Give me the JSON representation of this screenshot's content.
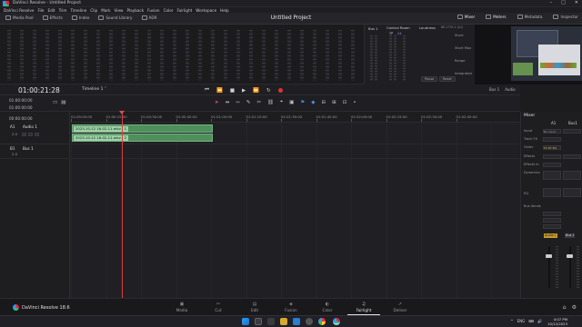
{
  "window": {
    "title": "DaVinci Resolve - Untitled Project",
    "controls": [
      "–",
      "□",
      "✕"
    ]
  },
  "menu": [
    "DaVinci Resolve",
    "File",
    "Edit",
    "Trim",
    "Timeline",
    "Clip",
    "Mark",
    "View",
    "Playback",
    "Fusion",
    "Color",
    "Fairlight",
    "Workspace",
    "Help"
  ],
  "toolbar": {
    "left": [
      "Media Pool",
      "Effects",
      "Index",
      "Sound Library",
      "ADR"
    ],
    "project_title": "Untitled Project",
    "right": [
      "Mixer",
      "Meters",
      "Metadata",
      "Inspector"
    ]
  },
  "control_room": {
    "title": "Control Room",
    "tp_label": "TP",
    "tp_value": "-24",
    "bus": "Bus 1",
    "loudness_title": "Loudness",
    "loudness_standard": "BS.1770-1 (LU)",
    "rows": [
      "Short",
      "Short Max",
      "Range",
      "Integrated"
    ],
    "pause": "Pause",
    "reset": "Reset"
  },
  "timeline_header": {
    "timecode": "01:00:21:28",
    "timeline_name": "Timeline 1",
    "bus_out": "Bus 1",
    "audio_label": "Audio"
  },
  "track_headers": {
    "tc_rows": [
      "01:00:00:00",
      "01:00:00:00",
      "00:00:00:00"
    ],
    "tracks": [
      {
        "id": "A1",
        "name": "Audio 1",
        "sub": "2.0"
      },
      {
        "id": "B1",
        "name": "Bus 1",
        "sub": "2.0"
      }
    ]
  },
  "ruler": [
    "01:00:00:00",
    "01:00:15:00",
    "01:00:30:00",
    "01:00:45:00",
    "01:01:00:00",
    "01:01:15:00",
    "01:01:30:00",
    "01:01:45:00",
    "01:02:00:00",
    "01:02:15:00",
    "01:02:30:00",
    "01:02:45:00"
  ],
  "clips": [
    {
      "label": "2023-10-12 16-02-11.mkv - 1"
    },
    {
      "label": "2023-10-12 16-02-11.mkv - 2"
    }
  ],
  "mixer": {
    "title": "Mixer",
    "columns": [
      "A1",
      "Bus1"
    ],
    "rows": [
      "Input",
      "Track FX",
      "Order",
      "Effects",
      "Effects In",
      "Dynamics",
      "EQ",
      "Bus Sends"
    ],
    "input_value": "No Input",
    "order_value": "FX DY EQ",
    "bus_tags": [
      "Audio 1",
      "Bus 1"
    ]
  },
  "pages": [
    {
      "name": "Media",
      "icon": "▣"
    },
    {
      "name": "Cut",
      "icon": "✂"
    },
    {
      "name": "Edit",
      "icon": "▤"
    },
    {
      "name": "Fusion",
      "icon": "◈"
    },
    {
      "name": "Color",
      "icon": "◐"
    },
    {
      "name": "Fairlight",
      "icon": "♫"
    },
    {
      "name": "Deliver",
      "icon": "➚"
    }
  ],
  "brand": "DaVinci Resolve 18.6",
  "taskbar": {
    "time": "4:07 PM",
    "date": "10/12/2023",
    "tray": [
      "^",
      "ENG",
      "⌨",
      "🔊"
    ]
  }
}
